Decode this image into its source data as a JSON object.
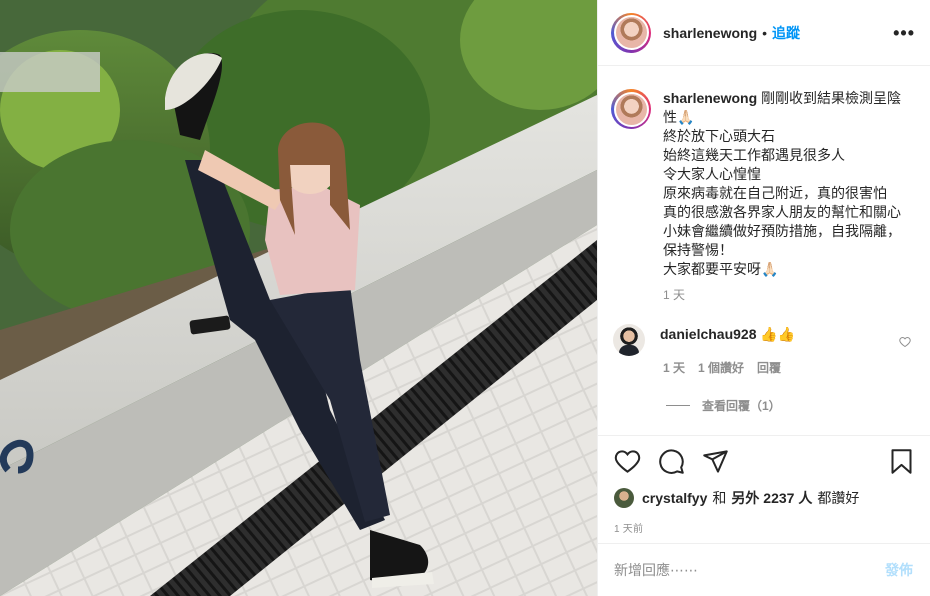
{
  "post": {
    "username": "sharlenewong",
    "follow_label": "追蹤",
    "dot": "•",
    "more_label": "•••",
    "caption": {
      "username": "sharlenewong",
      "lines": [
        "剛剛收到結果檢測呈陰",
        "性🙏🏻",
        "終於放下心頭大石",
        "始終這幾天工作都遇見很多人",
        "令大家人心惶惶",
        "原來病毒就在自己附近，真的很害怕",
        "真的很感激各界家人朋友的幫忙和關心",
        "小妹會繼續做好預防措施，自我隔離，",
        "保持警惕！",
        "大家都要平安呀🙏🏻"
      ],
      "age": "1 天"
    },
    "comments": [
      {
        "username": "danielchau928",
        "text": "👍👍",
        "age": "1 天",
        "likes": "1 個讚好",
        "reply_label": "回覆",
        "view_replies": "查看回覆（1）"
      }
    ],
    "likes": {
      "first_liker": "crystalfyy",
      "and_label": "和",
      "others_label": "另外 2237 人",
      "suffix": "都讚好"
    },
    "timestamp": "1 天前",
    "comment_box": {
      "placeholder": "新增回應⋯⋯",
      "post_label": "發佈"
    }
  },
  "icons": {
    "heart": "heart-icon",
    "comment": "comment-icon",
    "share": "share-icon",
    "bookmark": "bookmark-icon",
    "more": "more-icon"
  },
  "colors": {
    "accent": "#0095f6",
    "post_disabled": "#b2dffc",
    "muted": "#8e8e8e",
    "text": "#262626",
    "border": "#efefef"
  }
}
